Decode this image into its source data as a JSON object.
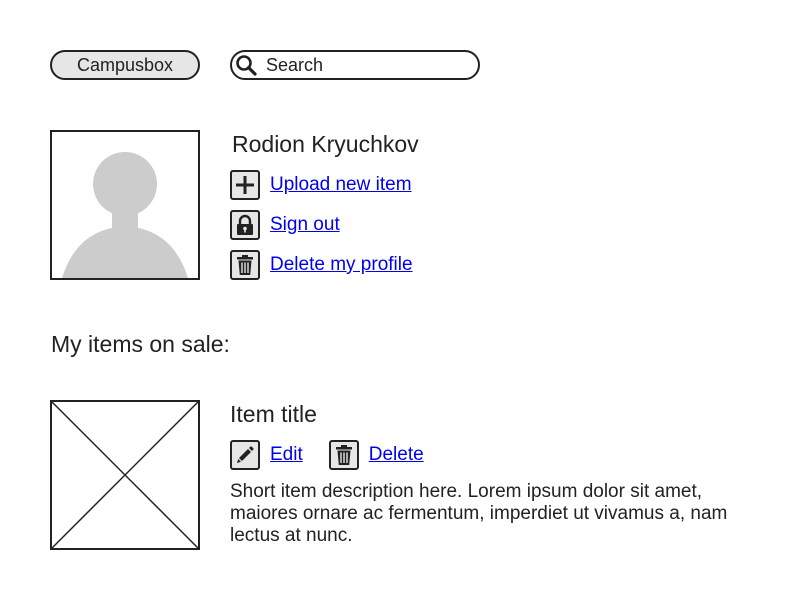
{
  "header": {
    "brand_label": "Campusbox",
    "search_placeholder": "Search",
    "search_value": ""
  },
  "profile": {
    "name": "Rodion Kryuchkov",
    "actions": [
      {
        "label": "Upload new item",
        "icon": "plus-icon"
      },
      {
        "label": "Sign out",
        "icon": "lock-icon"
      },
      {
        "label": "Delete my profile",
        "icon": "trash-icon"
      }
    ]
  },
  "items_section": {
    "heading": "My items on sale:",
    "items": [
      {
        "title": "Item title",
        "edit_label": "Edit",
        "delete_label": "Delete",
        "description": "Short item description here. Lorem ipsum dolor sit amet, maiores ornare ac fermentum, imperdiet ut vivamus a, nam lectus at nunc."
      }
    ]
  },
  "colors": {
    "link": "#0000ee",
    "border": "#222222",
    "icon_background": "#e6e6e6",
    "avatar_silhouette": "#cccccc"
  }
}
